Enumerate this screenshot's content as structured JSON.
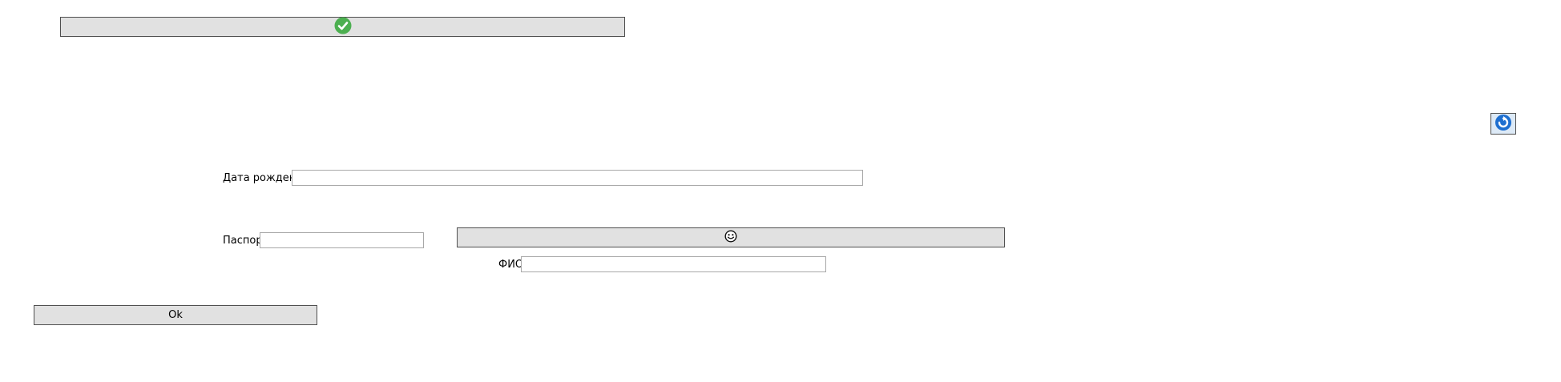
{
  "top_button": {
    "icon": "green-check-circle-icon",
    "color": "#4caf50"
  },
  "refresh_button": {
    "icon": "blue-refresh-circle-icon",
    "color": "#1e6fd0"
  },
  "birth_date": {
    "label": "Дата рождения",
    "value": ""
  },
  "passport": {
    "label": "Паспорт",
    "value": ""
  },
  "face_button": {
    "icon": "smiley-face-icon"
  },
  "full_name": {
    "label": "ФИО",
    "value": ""
  },
  "ok_button": {
    "label": "Ok"
  }
}
